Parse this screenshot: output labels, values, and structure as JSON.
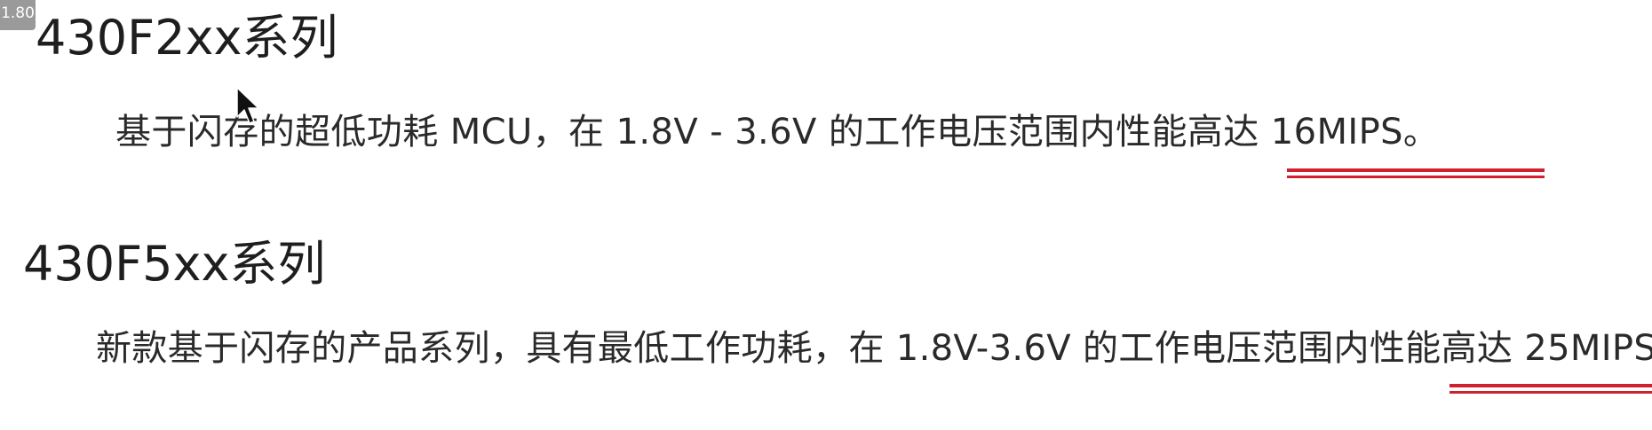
{
  "badge": {
    "value": "1.80"
  },
  "sections": [
    {
      "title": "430F2xx系列",
      "description": "基于闪存的超低功耗 MCU，在 1.8V - 3.6V 的工作电压范围内性能高达 16MIPS。",
      "highlight": "16MIPS"
    },
    {
      "title": "430F5xx系列",
      "description": "新款基于闪存的产品系列，具有最低工作功耗，在 1.8V-3.6V 的工作电压范围内性能高达 25MIPS",
      "highlight": "25MIPS"
    }
  ],
  "colors": {
    "underline": "#d0202e",
    "badge_bg": "#9a9a9a",
    "text": "#222222",
    "background": "#ffffff"
  },
  "icons": {
    "cursor": "mouse-pointer-icon"
  }
}
